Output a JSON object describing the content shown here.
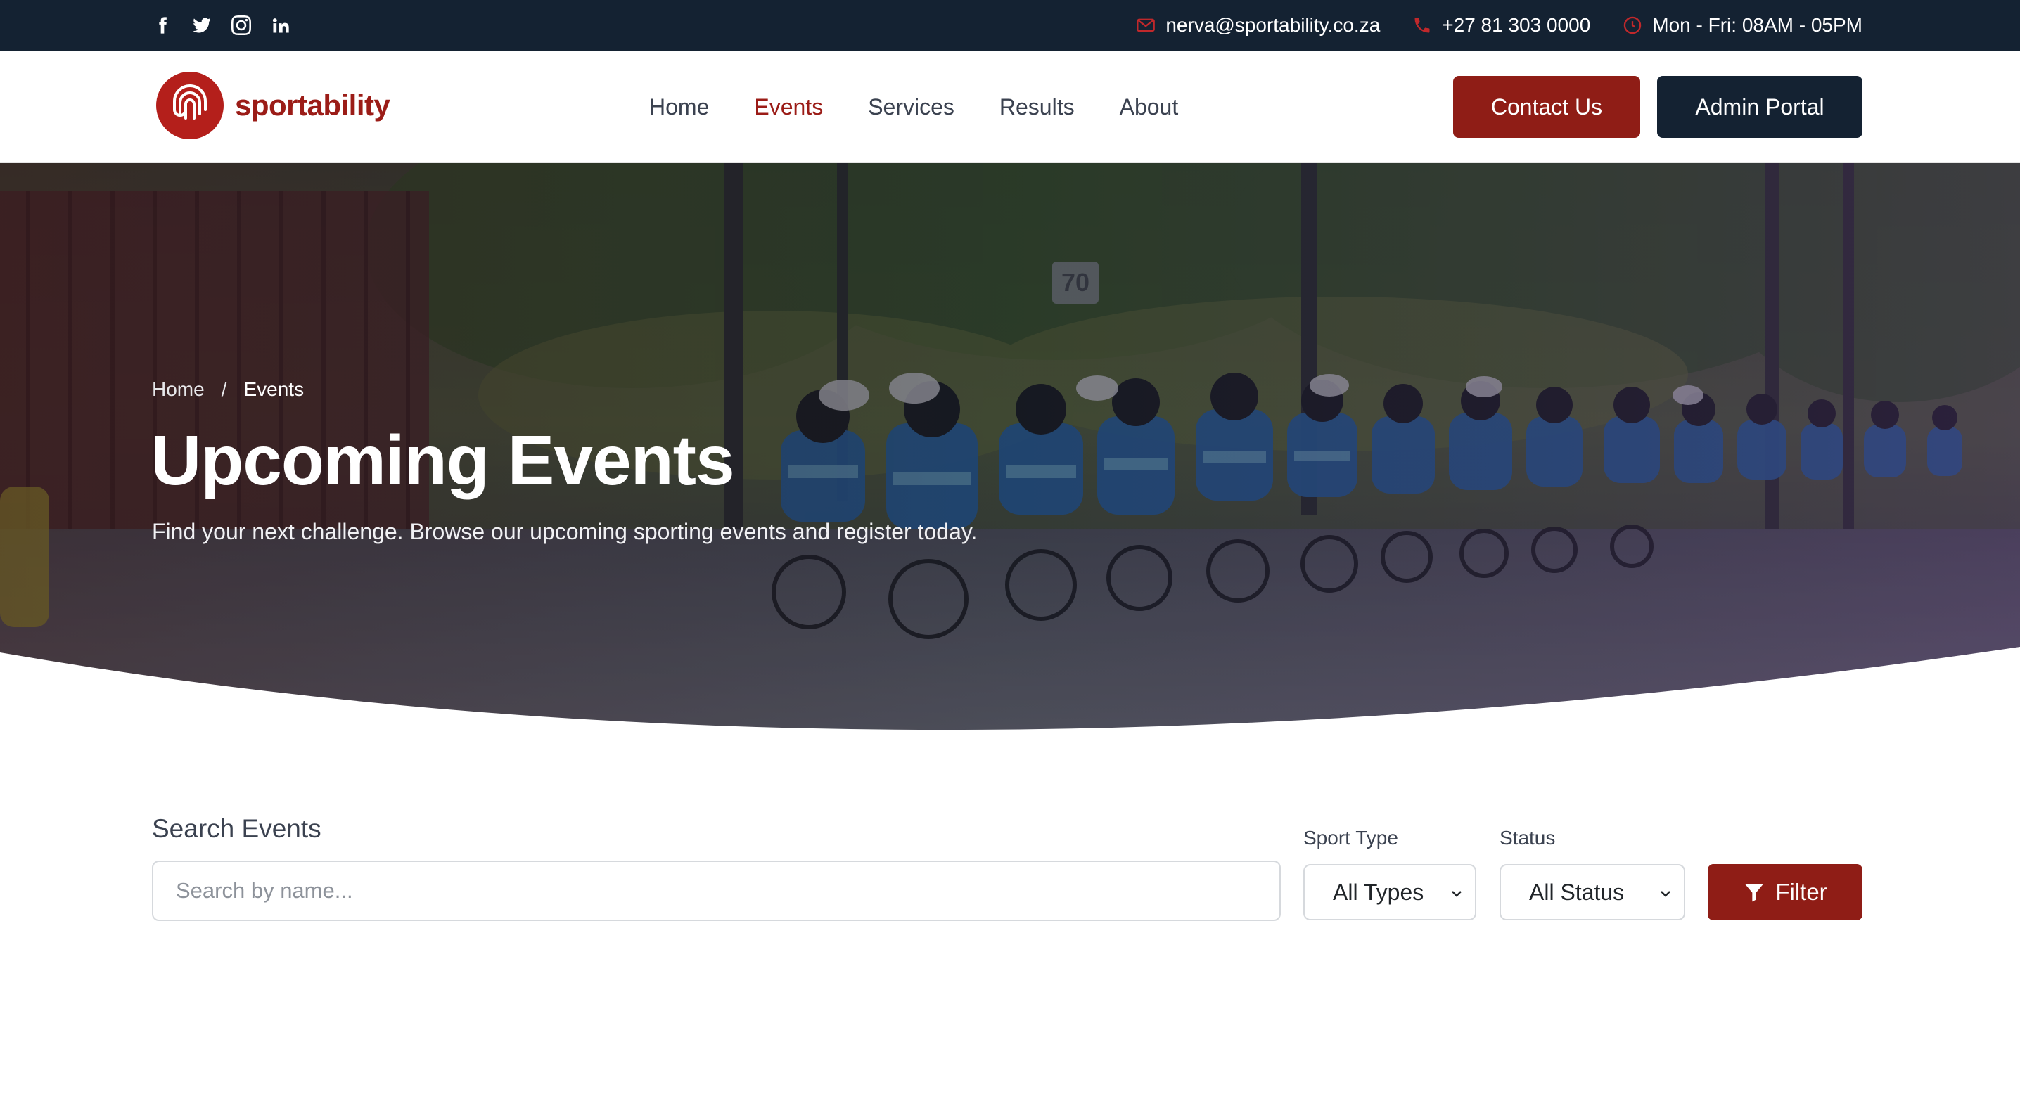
{
  "topbar": {
    "social": [
      {
        "icon": "facebook-icon"
      },
      {
        "icon": "twitter-icon"
      },
      {
        "icon": "instagram-icon"
      },
      {
        "icon": "linkedin-icon"
      }
    ],
    "email": "nerva@sportability.co.za",
    "phone": "+27 81 303 0000",
    "hours": "Mon - Fri: 08AM - 05PM"
  },
  "brand": {
    "name": "sportability",
    "color": "#9b1c17",
    "dark": "#142232"
  },
  "nav": {
    "links": [
      {
        "label": "Home",
        "active": false
      },
      {
        "label": "Events",
        "active": true
      },
      {
        "label": "Services",
        "active": false
      },
      {
        "label": "Results",
        "active": false
      },
      {
        "label": "About",
        "active": false
      }
    ],
    "contact_label": "Contact Us",
    "admin_label": "Admin Portal"
  },
  "hero": {
    "breadcrumb_home": "Home",
    "breadcrumb_sep": "/",
    "breadcrumb_current": "Events",
    "title": "Upcoming Events",
    "subtitle": "Find your next challenge. Browse our upcoming sporting events and register today.",
    "sign_text": "70"
  },
  "search": {
    "label": "Search Events",
    "placeholder": "Search by name...",
    "sport_type_label": "Sport Type",
    "sport_type_value": "All Types",
    "status_label": "Status",
    "status_value": "All Status",
    "filter_label": "Filter"
  }
}
